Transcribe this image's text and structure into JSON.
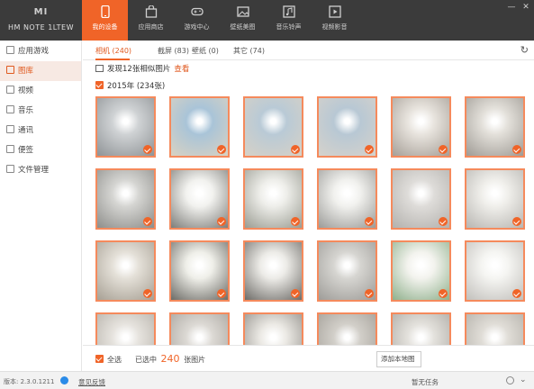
{
  "window": {
    "device_logo": "MI",
    "device_name": "HM NOTE 1LTEW",
    "controls": [
      "—",
      "✕"
    ]
  },
  "nav": [
    {
      "label": "我的设备",
      "icon": "phone-icon",
      "active": true
    },
    {
      "label": "应用商店",
      "icon": "bag-icon",
      "active": false
    },
    {
      "label": "游戏中心",
      "icon": "gamepad-icon",
      "active": false
    },
    {
      "label": "壁纸美图",
      "icon": "image-icon",
      "active": false
    },
    {
      "label": "音乐铃声",
      "icon": "music-icon",
      "active": false
    },
    {
      "label": "视频影音",
      "icon": "video-icon",
      "active": false
    }
  ],
  "sidebar": {
    "items": [
      {
        "label": "应用游戏",
        "icon": "apps-icon",
        "active": false
      },
      {
        "label": "图库",
        "icon": "gallery-icon",
        "active": true
      },
      {
        "label": "视频",
        "icon": "play-icon",
        "active": false
      },
      {
        "label": "音乐",
        "icon": "music-note-icon",
        "active": false
      },
      {
        "label": "通讯",
        "icon": "contacts-icon",
        "active": false
      },
      {
        "label": "便签",
        "icon": "note-icon",
        "active": false
      },
      {
        "label": "文件管理",
        "icon": "folder-icon",
        "active": false
      }
    ]
  },
  "tabs": [
    {
      "label": "相机 (240)",
      "active": true
    },
    {
      "label": "截屏 (83)",
      "active": false
    },
    {
      "label": "壁纸 (0)",
      "active": false
    },
    {
      "label": "其它 (74)",
      "active": false
    }
  ],
  "similar": {
    "text": "发现12张相似图片",
    "link": "查看"
  },
  "group": {
    "title": "2015年 (234张)"
  },
  "photos": [
    {
      "colors": [
        "#cfd2d4",
        "#8f9396"
      ]
    },
    {
      "colors": [
        "#a9c4d8",
        "#d9d2c2"
      ]
    },
    {
      "colors": [
        "#b9cad6",
        "#d7d1c6"
      ]
    },
    {
      "colors": [
        "#b8c8d4",
        "#d6d2cb"
      ]
    },
    {
      "colors": [
        "#e8e4de",
        "#a69f97"
      ]
    },
    {
      "colors": [
        "#e3e0da",
        "#9f9b95"
      ]
    },
    {
      "colors": [
        "#d5d5d2",
        "#8e8e8b"
      ]
    },
    {
      "colors": [
        "#f2f2ef",
        "#7d7d79"
      ]
    },
    {
      "colors": [
        "#eeeeea",
        "#9a9c92"
      ]
    },
    {
      "colors": [
        "#f1f1ee",
        "#9b9b98"
      ]
    },
    {
      "colors": [
        "#dedcd9",
        "#b3b1ad"
      ]
    },
    {
      "colors": [
        "#f0efeb",
        "#b8b6b2"
      ]
    },
    {
      "colors": [
        "#e4e0d8",
        "#a7a094"
      ]
    },
    {
      "colors": [
        "#efefe9",
        "#6c6b66"
      ]
    },
    {
      "colors": [
        "#ecebe7",
        "#6e6c68"
      ]
    },
    {
      "colors": [
        "#d6d5d1",
        "#9e9c98"
      ]
    },
    {
      "colors": [
        "#f3f3ee",
        "#8fb08c"
      ]
    },
    {
      "colors": [
        "#f5f5f2",
        "#c2c0bc"
      ]
    },
    {
      "colors": [
        "#e6e3de",
        "#b3aea6"
      ]
    },
    {
      "colors": [
        "#dcd9d4",
        "#a5a19b"
      ]
    },
    {
      "colors": [
        "#ebe9e4",
        "#8d8a85"
      ]
    },
    {
      "colors": [
        "#d2cfc9",
        "#9f9b94"
      ]
    },
    {
      "colors": [
        "#e3e1dc",
        "#a9a6a0"
      ]
    },
    {
      "colors": [
        "#e0ddd7",
        "#b0ada6"
      ]
    }
  ],
  "actionbar": {
    "select_all": "全选",
    "selected_prefix": "已选中",
    "selected_count": "240",
    "selected_suffix": "张图片",
    "add_button": "添加本地图"
  },
  "statusbar": {
    "version": "版本: 2.3.0.1211",
    "feedback": "意见反馈",
    "tasks": "暂无任务"
  },
  "colors": {
    "accent": "#f06428",
    "topbar": "#3b3b3b"
  }
}
